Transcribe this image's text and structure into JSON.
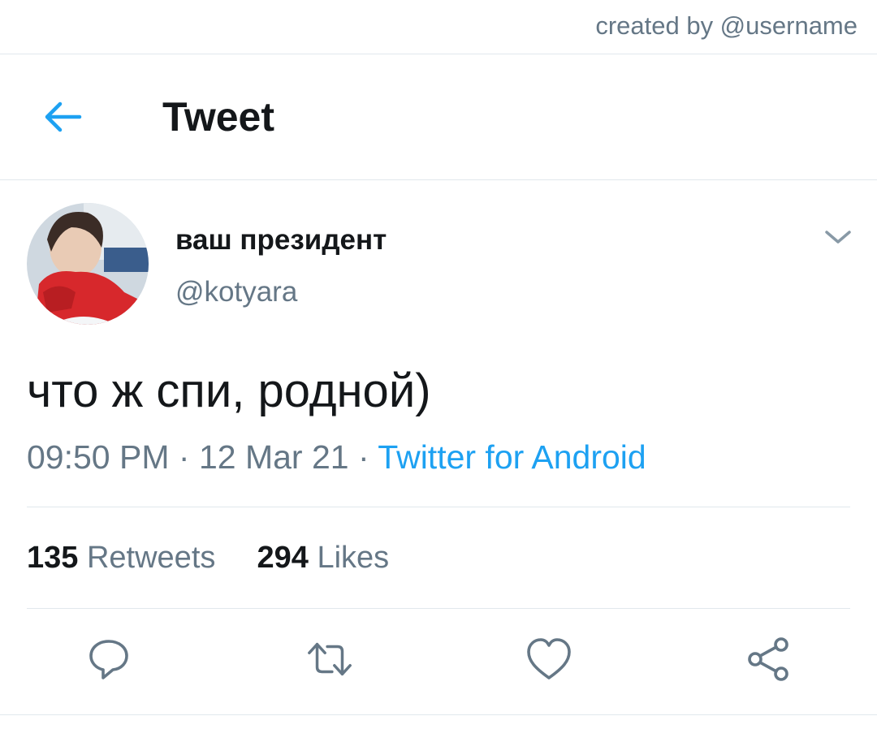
{
  "watermark": "created by @username",
  "header": {
    "title": "Tweet"
  },
  "tweet": {
    "display_name": "ваш президент",
    "handle": "@kotyara",
    "text": "что ж спи, родной)",
    "time": "09:50 PM",
    "date": "12 Mar 21",
    "separator": "·",
    "source": "Twitter for Android",
    "retweets_count": "135",
    "retweets_label": "Retweets",
    "likes_count": "294",
    "likes_label": "Likes"
  },
  "icons": {
    "back": "arrow-left-icon",
    "caret": "chevron-down-icon",
    "reply": "reply-icon",
    "retweet": "retweet-icon",
    "like": "heart-icon",
    "share": "share-icon"
  },
  "colors": {
    "accent": "#1da1f2",
    "text": "#14171a",
    "secondary": "#657786",
    "divider": "#e1e8ed"
  }
}
